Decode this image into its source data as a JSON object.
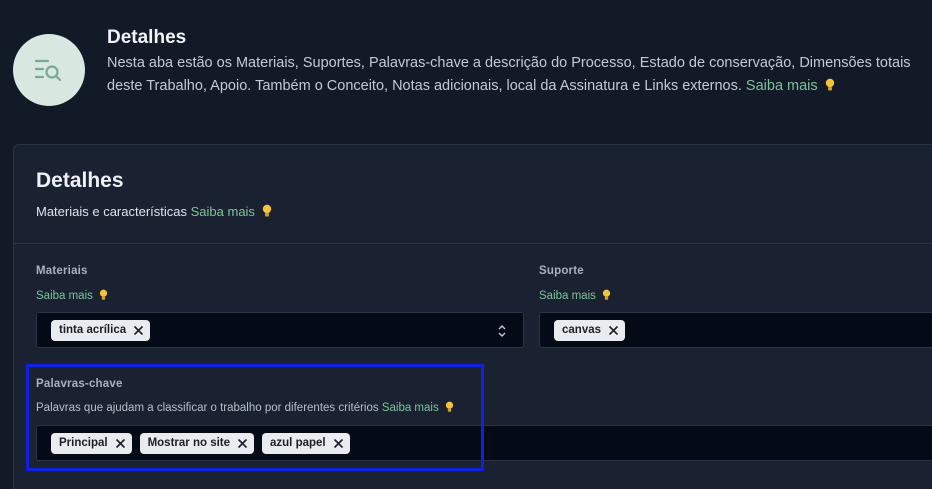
{
  "header": {
    "icon": "list-search-icon",
    "title": "Detalhes",
    "description": "Nesta aba estão os Materiais, Suportes, Palavras-chave a descrição do Processo, Estado de conservação, Dimensões totais deste Trabalho, Apoio. Também o Conceito, Notas adicionais, local da Assinatura e Links externos.",
    "learn_more": "Saiba mais"
  },
  "card": {
    "title": "Detalhes",
    "subtitle": "Materiais e características",
    "learn_more": "Saiba mais"
  },
  "fields": {
    "materiais": {
      "label": "Materiais",
      "help_link": "Saiba mais",
      "chips": [
        "tinta acrílica"
      ]
    },
    "suporte": {
      "label": "Suporte",
      "help_link": "Saiba mais",
      "chips": [
        "canvas"
      ]
    },
    "palavras": {
      "label": "Palavras-chave",
      "help": "Palavras que ajudam a classificar o trabalho por diferentes critérios",
      "help_link": "Saiba mais",
      "chips": [
        "Principal",
        "Mostrar no site",
        "azul papel"
      ]
    }
  },
  "colors": {
    "background": "#121a28",
    "card": "#1a2232",
    "accent_link": "#7ec29b",
    "highlight": "#1020e0",
    "bulb": "#f5c33b"
  }
}
